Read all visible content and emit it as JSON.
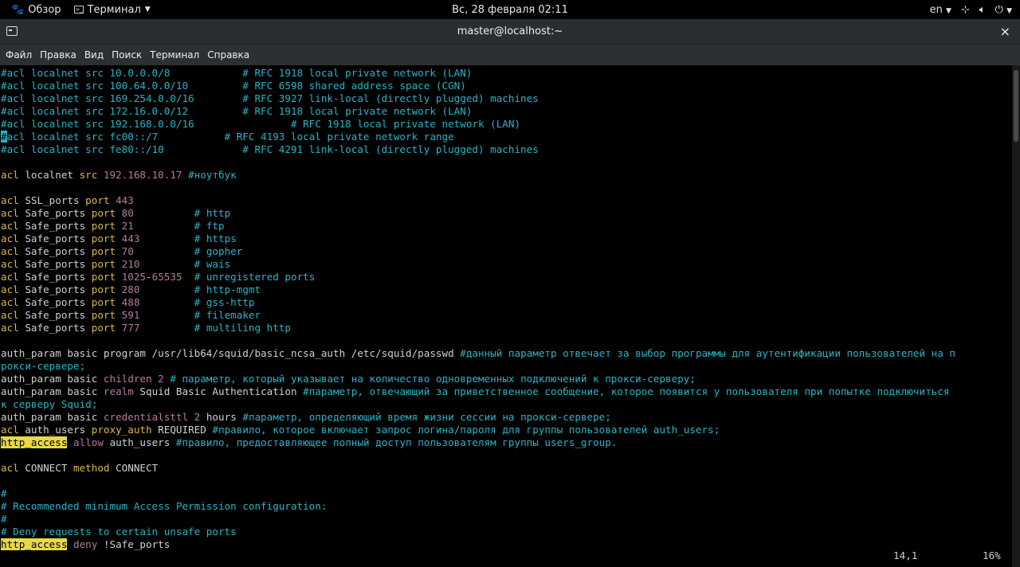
{
  "topbar": {
    "overview": "Обзор",
    "app": "Терминал",
    "clock": "Вс, 28 февраля  02:11",
    "lang": "en"
  },
  "window": {
    "title": "master@localhost:~",
    "close": "×"
  },
  "menu": [
    "Файл",
    "Правка",
    "Вид",
    "Поиск",
    "Терминал",
    "Справка"
  ],
  "editor": {
    "lines": [
      {
        "y": 0,
        "parts": [
          [
            "c",
            "#acl localnet src 10.0.0.0/8            # RFC 1918 local private network (LAN)"
          ]
        ]
      },
      {
        "y": 1,
        "parts": [
          [
            "c",
            "#acl localnet src 100.64.0.0/10         # RFC 6598 shared address space (CGN)"
          ]
        ]
      },
      {
        "y": 2,
        "parts": [
          [
            "c",
            "#acl localnet src 169.254.0.0/16        # RFC 3927 link-local (directly plugged) machines"
          ]
        ]
      },
      {
        "y": 3,
        "parts": [
          [
            "c",
            "#acl localnet src 172.16.0.0/12         # RFC 1918 local private network (LAN)"
          ]
        ]
      },
      {
        "y": 4,
        "parts": [
          [
            "c",
            "#acl localnet src 192.168.0.0/16                # RFC 1918 local private network (LAN)"
          ]
        ]
      },
      {
        "y": 5,
        "parts": [
          [
            "cur",
            "#"
          ],
          [
            "c",
            "acl localnet src fc00::/7           # RFC 4193 local private network range"
          ]
        ]
      },
      {
        "y": 6,
        "parts": [
          [
            "c",
            "#acl localnet src fe80::/10             # RFC 4291 link-local (directly plugged) machines"
          ]
        ]
      },
      {
        "y": 8,
        "parts": [
          [
            "k",
            "acl"
          ],
          [
            "w",
            " localnet "
          ],
          [
            "k",
            "src"
          ],
          [
            "n",
            " 192.168.10.17 "
          ],
          [
            "c",
            "#ноутбук"
          ]
        ]
      },
      {
        "y": 10,
        "parts": [
          [
            "k",
            "acl"
          ],
          [
            "w",
            " SSL_ports "
          ],
          [
            "k",
            "port"
          ],
          [
            "n",
            " 443"
          ]
        ]
      },
      {
        "y": 11,
        "parts": [
          [
            "k",
            "acl"
          ],
          [
            "w",
            " Safe_ports "
          ],
          [
            "k",
            "port"
          ],
          [
            "n",
            " 80          "
          ],
          [
            "c",
            "# http"
          ]
        ]
      },
      {
        "y": 12,
        "parts": [
          [
            "k",
            "acl"
          ],
          [
            "w",
            " Safe_ports "
          ],
          [
            "k",
            "port"
          ],
          [
            "n",
            " 21          "
          ],
          [
            "c",
            "# ftp"
          ]
        ]
      },
      {
        "y": 13,
        "parts": [
          [
            "k",
            "acl"
          ],
          [
            "w",
            " Safe_ports "
          ],
          [
            "k",
            "port"
          ],
          [
            "n",
            " 443         "
          ],
          [
            "c",
            "# https"
          ]
        ]
      },
      {
        "y": 14,
        "parts": [
          [
            "k",
            "acl"
          ],
          [
            "w",
            " Safe_ports "
          ],
          [
            "k",
            "port"
          ],
          [
            "n",
            " 70          "
          ],
          [
            "c",
            "# gopher"
          ]
        ]
      },
      {
        "y": 15,
        "parts": [
          [
            "k",
            "acl"
          ],
          [
            "w",
            " Safe_ports "
          ],
          [
            "k",
            "port"
          ],
          [
            "n",
            " 210         "
          ],
          [
            "c",
            "# wais"
          ]
        ]
      },
      {
        "y": 16,
        "parts": [
          [
            "k",
            "acl"
          ],
          [
            "w",
            " Safe_ports "
          ],
          [
            "k",
            "port"
          ],
          [
            "n",
            " 1025"
          ],
          [
            "w",
            "-"
          ],
          [
            "n",
            "65535  "
          ],
          [
            "c",
            "# unregistered ports"
          ]
        ]
      },
      {
        "y": 17,
        "parts": [
          [
            "k",
            "acl"
          ],
          [
            "w",
            " Safe_ports "
          ],
          [
            "k",
            "port"
          ],
          [
            "n",
            " 280         "
          ],
          [
            "c",
            "# http-mgmt"
          ]
        ]
      },
      {
        "y": 18,
        "parts": [
          [
            "k",
            "acl"
          ],
          [
            "w",
            " Safe_ports "
          ],
          [
            "k",
            "port"
          ],
          [
            "n",
            " 488         "
          ],
          [
            "c",
            "# gss-http"
          ]
        ]
      },
      {
        "y": 19,
        "parts": [
          [
            "k",
            "acl"
          ],
          [
            "w",
            " Safe_ports "
          ],
          [
            "k",
            "port"
          ],
          [
            "n",
            " 591         "
          ],
          [
            "c",
            "# filemaker"
          ]
        ]
      },
      {
        "y": 20,
        "parts": [
          [
            "k",
            "acl"
          ],
          [
            "w",
            " Safe_ports "
          ],
          [
            "k",
            "port"
          ],
          [
            "n",
            " 777         "
          ],
          [
            "c",
            "# multiling http"
          ]
        ]
      },
      {
        "y": 22,
        "parts": [
          [
            "w",
            "auth_param basic program /usr/lib64/squid/basic_ncsa_auth /etc/squid/passwd "
          ],
          [
            "c",
            "#данный параметр отвечает за выбор программы для аутентификации пользователей на п"
          ]
        ]
      },
      {
        "y": 23,
        "parts": [
          [
            "c",
            "рокси-сервере;"
          ]
        ]
      },
      {
        "y": 24,
        "parts": [
          [
            "w",
            "auth_param basic "
          ],
          [
            "n",
            "children 2 "
          ],
          [
            "c",
            "# параметр, который указывает на количество одновременных подключений к прокси-серверу;"
          ]
        ]
      },
      {
        "y": 25,
        "parts": [
          [
            "w",
            "auth_param basic "
          ],
          [
            "n",
            "realm"
          ],
          [
            "w",
            " Squid Basic Authentication "
          ],
          [
            "c",
            "#параметр, отвечающий за приветственное сообщение, которое появится у пользователя при попытке подключиться"
          ]
        ]
      },
      {
        "y": 26,
        "parts": [
          [
            "c",
            "к серверу Squid;"
          ]
        ]
      },
      {
        "y": 27,
        "parts": [
          [
            "w",
            "auth_param basic "
          ],
          [
            "n",
            "credentialsttl 2"
          ],
          [
            "w",
            " hours "
          ],
          [
            "c",
            "#параметр, определяющий время жизни сессии на прокси-сервере;"
          ]
        ]
      },
      {
        "y": 28,
        "parts": [
          [
            "k",
            "acl"
          ],
          [
            "w",
            " auth_users "
          ],
          [
            "k",
            "proxy_auth"
          ],
          [
            "w",
            " REQUIRED "
          ],
          [
            "c",
            "#правило, которое включает запрос логина/пароля для группы пользователей auth_users;"
          ]
        ]
      },
      {
        "y": 29,
        "parts": [
          [
            "hl",
            "http_access"
          ],
          [
            "n",
            " allow"
          ],
          [
            "w",
            " auth_users "
          ],
          [
            "c",
            "#правило, предоставляющее полный доступ пользователям группы users_group."
          ]
        ]
      },
      {
        "y": 31,
        "parts": [
          [
            "k",
            "acl"
          ],
          [
            "w",
            " CONNECT "
          ],
          [
            "k",
            "method"
          ],
          [
            "w",
            " CONNECT"
          ]
        ]
      },
      {
        "y": 33,
        "parts": [
          [
            "c",
            "#"
          ]
        ]
      },
      {
        "y": 34,
        "parts": [
          [
            "c",
            "# Recommended minimum Access Permission configuration:"
          ]
        ]
      },
      {
        "y": 35,
        "parts": [
          [
            "c",
            "#"
          ]
        ]
      },
      {
        "y": 36,
        "parts": [
          [
            "c",
            "# Deny requests to certain unsafe ports"
          ]
        ]
      },
      {
        "y": 37,
        "parts": [
          [
            "hl",
            "http_access"
          ],
          [
            "n",
            " deny"
          ],
          [
            "w",
            " !Safe_ports"
          ]
        ]
      }
    ],
    "position": "14,1",
    "percent": "16%"
  }
}
